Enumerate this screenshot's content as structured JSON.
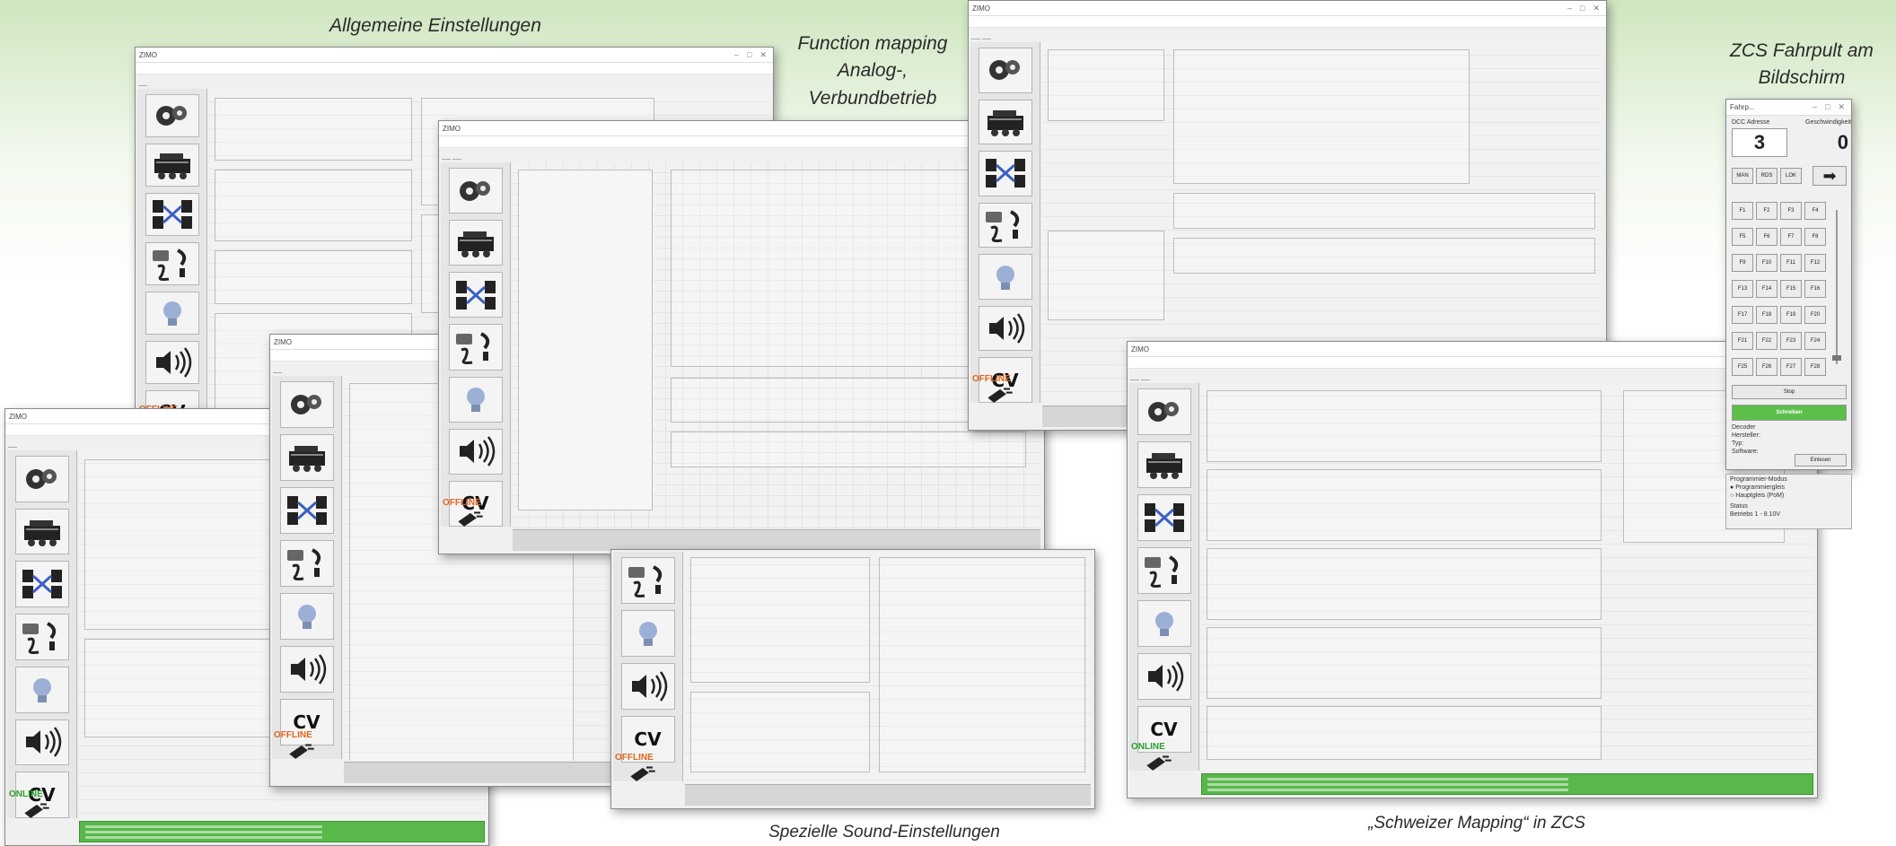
{
  "captions": {
    "general": "Allgemeine Einstellungen",
    "function_mapping": "Function mapping\nAnalog-,\nVerbundbetrieb",
    "zcs": "ZCS Fahrpult am\nBildschirm",
    "sound": "Spezielle Sound-Einstellungen",
    "swiss": "„Schweizer Mapping“ in ZCS"
  },
  "status": {
    "offline": "OFFLINE",
    "online": "ONLINE"
  },
  "sidebar_icons": [
    "decoder-icon",
    "locomotive-icon",
    "function-matrix-icon",
    "motor-settings-icon",
    "lightbulb-icon",
    "sound-icon",
    "cv-icon"
  ],
  "sidebar_cv": "CV",
  "zcs": {
    "title": "Fahrp...",
    "dcc_label": "DCC Adresse",
    "speed_label": "Geschwindigkeit",
    "address": "3",
    "speed": "0",
    "mode_buttons": [
      "MAN",
      "RDS",
      "LOK"
    ],
    "functions": [
      "F1",
      "F2",
      "F3",
      "F4",
      "F5",
      "F6",
      "F7",
      "F8",
      "F9",
      "F10",
      "F11",
      "F12",
      "F13",
      "F14",
      "F15",
      "F16",
      "F17",
      "F18",
      "F19",
      "F20",
      "F21",
      "F22",
      "F23",
      "F24",
      "F25",
      "F26",
      "F27",
      "F28"
    ],
    "stop_label": "Stop",
    "run_label": "Schreiben",
    "decoder_label": "Decoder",
    "hersteller": "Hersteller:",
    "typ": "Typ:",
    "software": "Software:",
    "read_label": "Einlesen",
    "prog_mode_label": "Programmier-Modus",
    "prog_opt1": "Programmiergleis",
    "prog_opt2": "Hauptgleis (PoM)",
    "status_label": "Status",
    "status_value": "Betriebs 1 - 8.10V"
  }
}
